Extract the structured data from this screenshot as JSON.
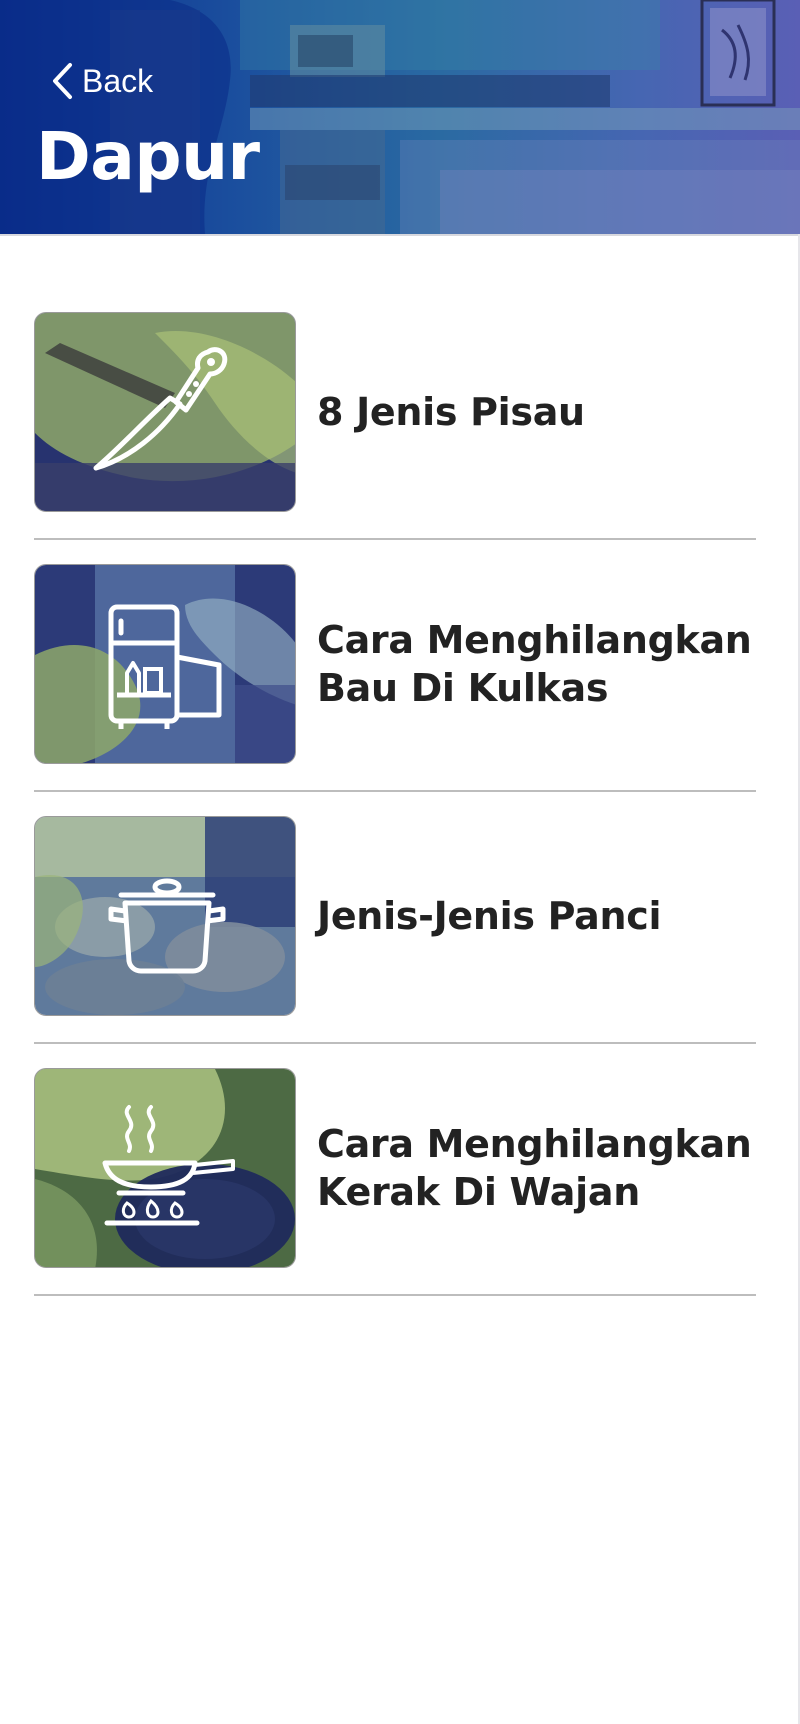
{
  "header": {
    "back_label": "Back",
    "title": "Dapur"
  },
  "items": [
    {
      "title": "8 Jenis Pisau",
      "icon": "knife-icon"
    },
    {
      "title": "Cara Menghilangkan Bau Di Kulkas",
      "icon": "refrigerator-icon"
    },
    {
      "title": "Jenis-Jenis Panci",
      "icon": "cooking-pot-icon"
    },
    {
      "title": "Cara Menghilangkan Kerak Di Wajan",
      "icon": "frying-pan-stove-icon"
    }
  ],
  "colors": {
    "header_blue": "#0c2f8c",
    "header_purple": "#5b63b8",
    "thumb_green": "#9fbf6a",
    "thumb_navy": "#1d2f6e",
    "title_text": "#222222",
    "divider": "#bdbdbd"
  }
}
